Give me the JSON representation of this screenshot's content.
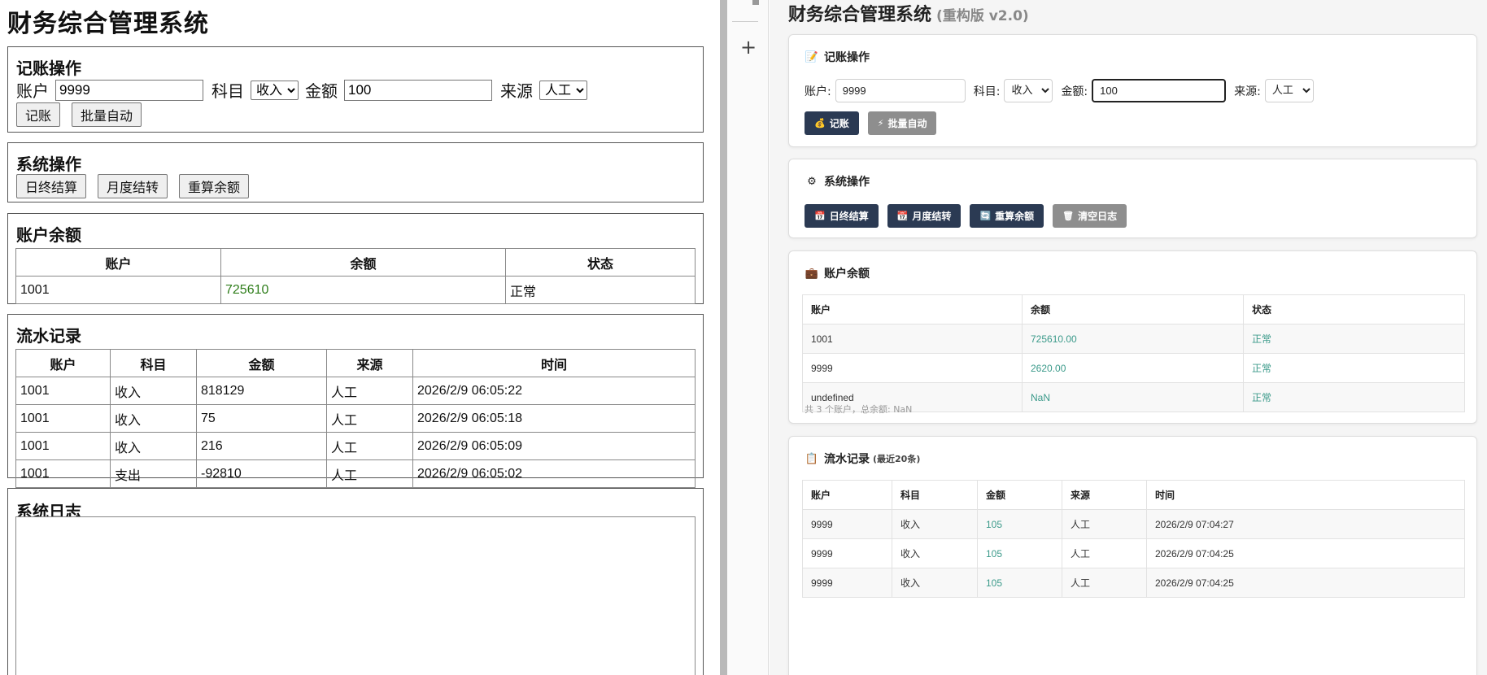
{
  "left": {
    "title": "财务综合管理系统",
    "bookkeeping": {
      "heading": "记账操作",
      "account_label": "账户",
      "account_value": "9999",
      "subject_label": "科目",
      "subject_selected": "收入",
      "amount_label": "金额",
      "amount_value": "100",
      "source_label": "来源",
      "source_selected": "人工",
      "record_btn": "记账",
      "batch_btn": "批量自动"
    },
    "system_ops": {
      "heading": "系统操作",
      "buttons": [
        "日终结算",
        "月度结转",
        "重算余额"
      ]
    },
    "balances": {
      "heading": "账户余额",
      "columns": [
        "账户",
        "余额",
        "状态"
      ],
      "rows": [
        [
          "1001",
          "725610",
          "正常"
        ]
      ]
    },
    "transactions": {
      "heading": "流水记录",
      "columns": [
        "账户",
        "科目",
        "金额",
        "来源",
        "时间"
      ],
      "rows": [
        [
          "1001",
          "收入",
          "818129",
          "人工",
          "2026/2/9 06:05:22"
        ],
        [
          "1001",
          "收入",
          "75",
          "人工",
          "2026/2/9 06:05:18"
        ],
        [
          "1001",
          "收入",
          "216",
          "人工",
          "2026/2/9 06:05:09"
        ],
        [
          "1001",
          "支出",
          "-92810",
          "人工",
          "2026/2/9 06:05:02"
        ]
      ]
    },
    "logs": {
      "heading": "系统日志"
    }
  },
  "right": {
    "title": "财务综合管理系统",
    "version": "(重构版 v2.0)",
    "bookkeeping": {
      "heading": "记账操作",
      "account_label": "账户:",
      "account_value": "9999",
      "subject_label": "科目:",
      "subject_selected": "收入",
      "amount_label": "金额:",
      "amount_value": "100",
      "source_label": "来源:",
      "source_selected": "人工",
      "record_btn": "记账",
      "batch_btn": "批量自动"
    },
    "system_ops": {
      "heading": "系统操作",
      "buttons": [
        {
          "label": "日终结算",
          "icon": "calendar-icon",
          "style": "dark"
        },
        {
          "label": "月度结转",
          "icon": "calendar-icon",
          "style": "dark"
        },
        {
          "label": "重算余额",
          "icon": "refresh-icon",
          "style": "dark"
        },
        {
          "label": "清空日志",
          "icon": "trash-icon",
          "style": "gray"
        }
      ]
    },
    "balances": {
      "heading": "账户余额",
      "columns": [
        "账户",
        "余额",
        "状态"
      ],
      "rows": [
        [
          "1001",
          "725610.00",
          "正常"
        ],
        [
          "9999",
          "2620.00",
          "正常"
        ],
        [
          "undefined",
          "NaN",
          "正常"
        ]
      ],
      "summary": "共 3 个账户，总余额: NaN"
    },
    "transactions": {
      "heading": "流水记录",
      "subheading": "(最近20条)",
      "columns": [
        "账户",
        "科目",
        "金额",
        "来源",
        "时间"
      ],
      "rows": [
        [
          "9999",
          "收入",
          "105",
          "人工",
          "2026/2/9 07:04:27"
        ],
        [
          "9999",
          "收入",
          "105",
          "人工",
          "2026/2/9 07:04:25"
        ],
        [
          "9999",
          "收入",
          "105",
          "人工",
          "2026/2/9 07:04:25"
        ]
      ]
    }
  },
  "colors": {
    "left_positive": "#2e7d1a",
    "right_accent": "#3b9a8a",
    "dark_button": "#2b3a53",
    "gray_button": "#8e8e8e"
  }
}
